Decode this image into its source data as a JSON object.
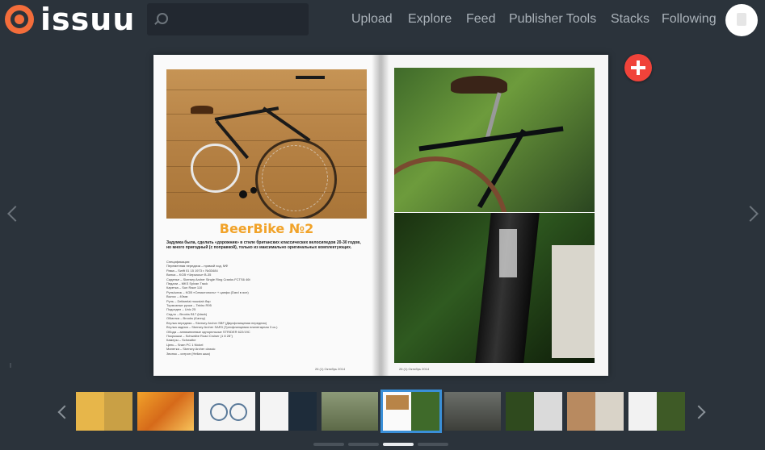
{
  "header": {
    "logo_text": "issuu",
    "search": {
      "placeholder": ""
    },
    "nav": [
      {
        "label": "Upload"
      },
      {
        "label": "Explore"
      },
      {
        "label": "Feed"
      },
      {
        "label": "Publisher Tools"
      },
      {
        "label": "Stacks"
      },
      {
        "label": "Following"
      }
    ]
  },
  "publication": {
    "left_page": {
      "title": "BeerBike №2",
      "intro": "Задумка была, сделать «дорожник» в стиле британских классических велосипедов 20-30 годов, но много пригодный (с поправкой), только из максимально оригинальных комплектующих.",
      "specs_heading": "Спецификация:",
      "specs": [
        "Переменная передача – прямой ход, МФ",
        "Рама – Swift 01 15 1973 г. №33484",
        "Вилка – KGB «Черкасы» B-35",
        "Сиденье – Skersey Archer Single Ring Cranks FCTS6 46t",
        "Педали – MKS Sylvan Track",
        "Каретка – Sun Race 110",
        "Руль/ынок – KGB «Севастополь» + цапфа (Dard в ясн)",
        "Вынос – 40мм",
        "Руль – Deltarelai moustah бар",
        "Тормозные ручки – Tektro R95",
        "Подседел – Unic 25",
        "Седло – Brooks B17 (black)",
        "Обмотка – Brooks (Kanny)",
        "Втулка передняя – Skersey Archer SBF (Двухфланцевая передняя)",
        "Втулка задняя – Skersey Archer SAR3 (Трехфланцевая планетарная 3 ск.)",
        "Обода – алюминиевые однорельсые STRIDER 622/19C",
        "Покрышки – Schwalbe Road Cruiser (1 8 28\")",
        "Камеры – Schwalbe",
        "Цепь – Sram PC 1 Nickel",
        "Манетка – Skersey Archer classic",
        "Звонок – ситроп (Hellan шык)"
      ],
      "footer": "26 (1) Октябрь 2014"
    },
    "right_page": {
      "footer": "26 (1) Октябрь 2014"
    }
  },
  "thumbnails": [
    {
      "label": "thumbnail 1",
      "active": false
    },
    {
      "label": "thumbnail 2",
      "active": false
    },
    {
      "label": "thumbnail 3",
      "active": false
    },
    {
      "label": "thumbnail 4",
      "active": false
    },
    {
      "label": "thumbnail 5",
      "active": false
    },
    {
      "label": "thumbnail 6",
      "active": true
    },
    {
      "label": "thumbnail 7",
      "active": false
    },
    {
      "label": "thumbnail 8",
      "active": false
    },
    {
      "label": "thumbnail 9",
      "active": false
    },
    {
      "label": "thumbnail 10",
      "active": false
    }
  ],
  "pagination": {
    "pages": 4,
    "active_index": 2
  },
  "colors": {
    "background": "#2b333b",
    "brand": "#f36d3b",
    "add": "#f0433a",
    "active_thumb": "#3a8fd8",
    "title": "#f1a32a"
  }
}
